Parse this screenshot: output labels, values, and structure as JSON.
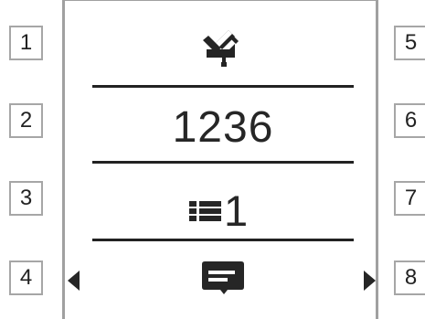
{
  "softkeys": {
    "left": [
      "1",
      "2",
      "3",
      "4"
    ],
    "right": [
      "5",
      "6",
      "7",
      "8"
    ]
  },
  "display": {
    "number": "1236",
    "queue_count": "1",
    "icons": {
      "top": "checkmark-pen-document-icon",
      "queue": "list-icon",
      "bottom": "message-bubble-icon",
      "left_arrow": "triangle-left-icon",
      "right_arrow": "triangle-right-icon"
    }
  },
  "colors": {
    "text": "#222222",
    "border": "#a6a6a6",
    "background": "#ffffff"
  }
}
